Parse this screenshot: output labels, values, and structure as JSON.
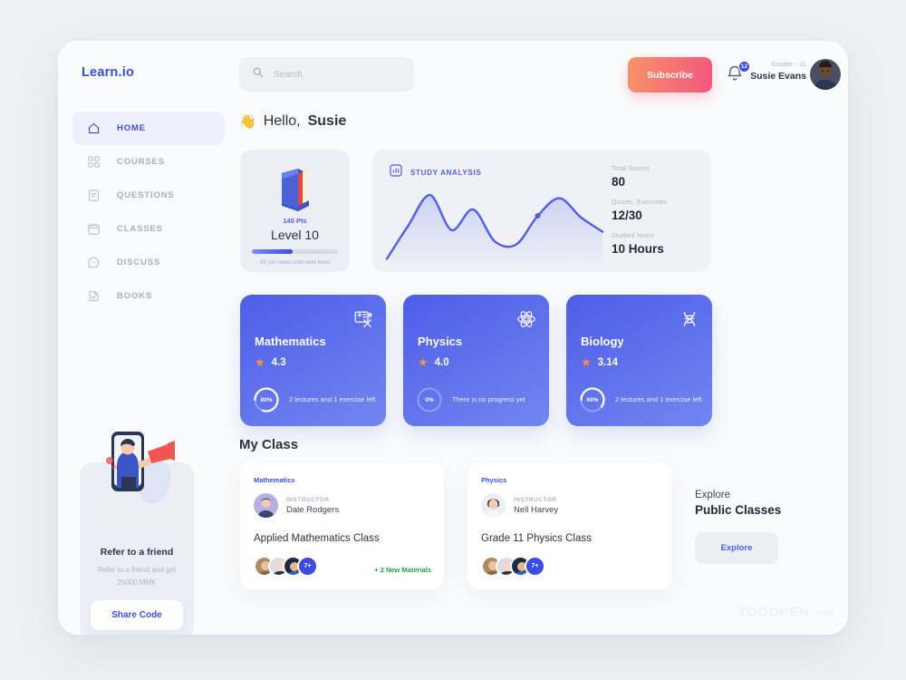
{
  "brand": "Learn.io",
  "search": {
    "placeholder": "Search",
    "value": "",
    "icon": "search-icon"
  },
  "header": {
    "subscribe_label": "Subscribe",
    "bell_icon": "bell-icon",
    "notification_count": "12",
    "user_grade": "Gradee - 11",
    "user_name": "Susie Evans",
    "avatar": "user-avatar"
  },
  "sidebar": {
    "items": [
      {
        "label": "HOME",
        "icon": "home-icon",
        "active": true
      },
      {
        "label": "COURSES",
        "icon": "grid-icon",
        "active": false
      },
      {
        "label": "QUESTIONS",
        "icon": "question-doc-icon",
        "active": false
      },
      {
        "label": "CLASSES",
        "icon": "calendar-icon",
        "active": false
      },
      {
        "label": "DISCUSS",
        "icon": "chat-bubble-icon",
        "active": false
      },
      {
        "label": "BOOKS",
        "icon": "book-doc-icon",
        "active": false
      }
    ],
    "refer": {
      "title": "Refer to a friend",
      "subtitle": "Refer to a friend and get 25000 MMK",
      "button": "Share Code",
      "illustration": "megaphone-person-illustration"
    }
  },
  "greeting": {
    "wave": "👋",
    "hello": "Hello,",
    "name": "Susie"
  },
  "level_card": {
    "icon": "book-icon",
    "points": "140 Pts",
    "level": "Level 10",
    "progress_percent": 47,
    "note": "60 pts need until next level"
  },
  "analysis": {
    "icon": "bar-chart-icon",
    "title": "STUDY ANALYSIS",
    "stats": [
      {
        "label": "Total Scores",
        "value": "80"
      },
      {
        "label": "Quizes,  Exercises",
        "value": "12/30"
      },
      {
        "label": "Studied hours",
        "value": "10 Hours"
      }
    ]
  },
  "chart_data": {
    "type": "line",
    "title": "STUDY ANALYSIS",
    "xlabel": "",
    "ylabel": "",
    "grid": false,
    "legend": "none",
    "x": [
      0,
      1,
      2,
      3,
      4,
      5,
      6,
      7,
      8,
      9,
      10
    ],
    "series": [
      {
        "name": "Study activity",
        "values": [
          4,
          46,
          84,
          40,
          66,
          26,
          22,
          58,
          80,
          56,
          38
        ]
      }
    ],
    "ylim": [
      0,
      100
    ],
    "annotations": [
      {
        "label": "marker",
        "x": 7,
        "y": 58
      }
    ],
    "area_fill": true,
    "line_color": "#4d5ee8"
  },
  "courses": [
    {
      "name": "Mathematics",
      "icon": "math-board-icon",
      "rating": "4.3",
      "progress": "80%",
      "progress_value": 80,
      "note": "2 lectures and 1 exercise left"
    },
    {
      "name": "Physics",
      "icon": "atom-icon",
      "rating": "4.0",
      "progress": "0%",
      "progress_value": 0,
      "note": "There is no progress yet"
    },
    {
      "name": "Biology",
      "icon": "dna-icon",
      "rating": "3.14",
      "progress": "60%",
      "progress_value": 60,
      "note": "2 lectures and 1 exercise left"
    }
  ],
  "my_class": {
    "title": "My Class",
    "cards": [
      {
        "subject": "Mathematics",
        "instructor_role": "INSTRUCTOR",
        "instructor_name": "Dale Rodgers",
        "class_name": "Applied Mathematics Class",
        "more_count": "7+",
        "badge": "+ 2 New Materials"
      },
      {
        "subject": "Physics",
        "instructor_role": "INSTRUCTOR",
        "instructor_name": "Nell Harvey",
        "class_name": "Grade 11 Physics Class",
        "more_count": "7+",
        "badge": ""
      }
    ]
  },
  "explore": {
    "kicker": "Explore",
    "title": "Public Classes",
    "button": "Explore"
  },
  "watermark": {
    "name": "TOOOPEN",
    "domain": ".com"
  },
  "colors": {
    "accent_blue": "#3b4ce2",
    "card_blue": "#4d5ee8",
    "subscribe_from": "#f79369",
    "subscribe_to": "#f3567e",
    "star_orange": "#fb8c4e",
    "green": "#24a148",
    "page_bg": "#eef0f4",
    "panel_bg": "#fafbfc"
  }
}
